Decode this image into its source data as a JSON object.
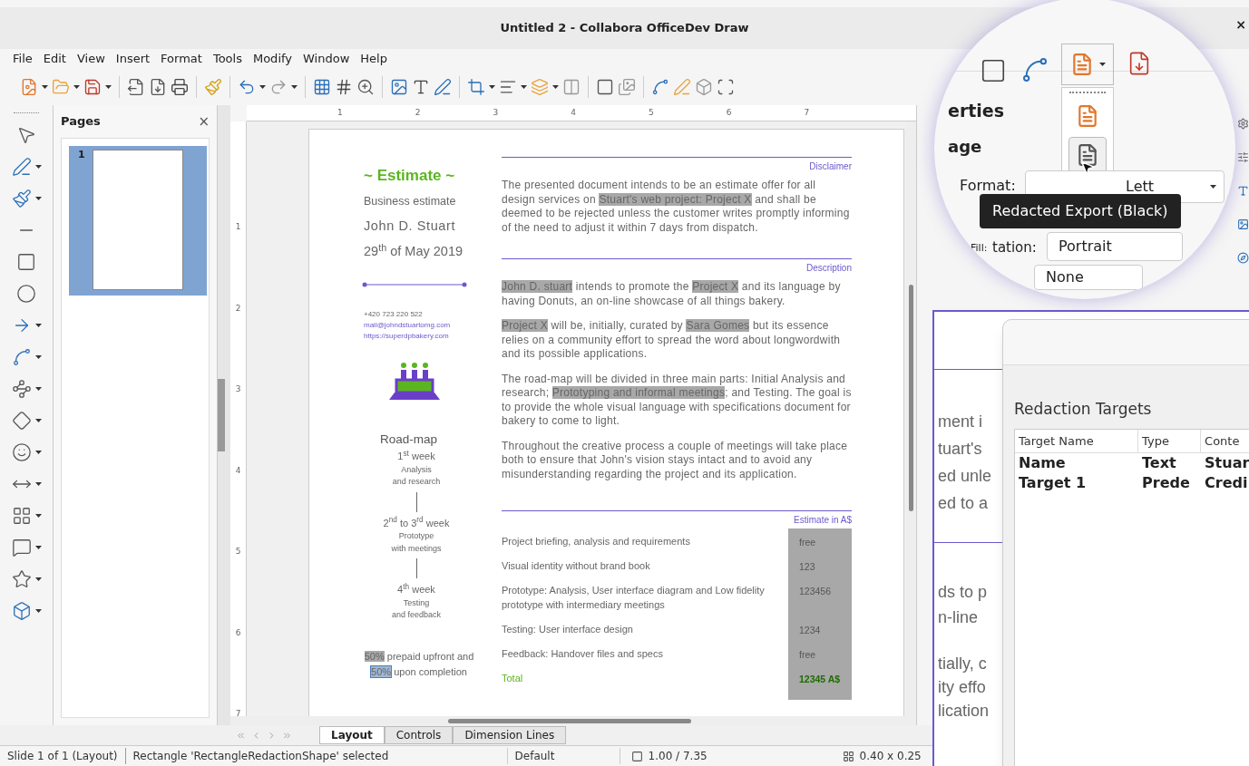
{
  "window": {
    "title": "Untitled 2 - Collabora OfficeDev Draw",
    "close": "×"
  },
  "menu": [
    "File",
    "Edit",
    "View",
    "Insert",
    "Format",
    "Tools",
    "Modify",
    "Window",
    "Help"
  ],
  "pages_panel": {
    "title": "Pages",
    "close": "×",
    "pages": [
      {
        "number": "1",
        "selected": true
      }
    ]
  },
  "ruler": {
    "h": [
      "1",
      "2",
      "3",
      "4",
      "5",
      "6",
      "7"
    ],
    "v": [
      "1",
      "2",
      "3",
      "4",
      "5",
      "6",
      "7"
    ]
  },
  "document": {
    "left": {
      "title": "~ Estimate ~",
      "subtitle": "Business estimate",
      "name": "John D. Stuart",
      "date": "29$^{th}$ of May 2019",
      "phone": "+420 723 220 522",
      "email": "mail@johndstuartomg.com",
      "url": "https://superdpbakery.com",
      "roadmap_title": "Road-map",
      "roadmap": [
        {
          "week": "1$^{st}$ week",
          "task": "Analysis",
          "task2": "and research"
        },
        {
          "week": "2$^{nd}$ to 3$^{rd}$ week",
          "task": "Prototype",
          "task2": "with meetings"
        },
        {
          "week": "4$^{th}$ week",
          "task": "Testing",
          "task2": "and feedback"
        }
      ],
      "payment": [
        {
          "text": "50%",
          "redacted": true,
          "selected": false
        },
        {
          "text": " prepaid upfront and ",
          "redacted": false,
          "selected": false
        },
        {
          "text": "50%",
          "redacted": true,
          "selected": true
        },
        {
          "text": " upon completion",
          "redacted": false,
          "selected": false
        }
      ]
    },
    "sections": [
      {
        "heading": "Disclaimer",
        "paragraphs": [
          [
            {
              "text": "The presented document intends to be an estimate offer for all design services on ",
              "redacted": false
            },
            {
              "text": "Stuart's web project: Project X",
              "redacted": true
            },
            {
              "text": " and shall be deemed to be rejected unless the customer writes promptly informing of the need to adjust it within 7 days from dispatch.",
              "redacted": false
            }
          ]
        ]
      },
      {
        "heading": "Description",
        "paragraphs": [
          [
            {
              "text": "John D. stuart",
              "redacted": true
            },
            {
              "text": " intends to promote the ",
              "redacted": false
            },
            {
              "text": "Project X",
              "redacted": true
            },
            {
              "text": " and its language by having Donuts, an on-line showcase of all things bakery.",
              "redacted": false
            }
          ],
          [
            {
              "text": "Project X",
              "redacted": true
            },
            {
              "text": " will be, initially, curated by ",
              "redacted": false
            },
            {
              "text": "Sara Gomes",
              "redacted": true
            },
            {
              "text": " but its essence relies on a community effort to spread the word about longwordwith and its possible applications.",
              "redacted": false
            }
          ],
          [
            {
              "text": "The road-map will be divided in three main parts: Initial Analysis and research; ",
              "redacted": false
            },
            {
              "text": "Prototyping and informal meetings",
              "redacted": true
            },
            {
              "text": "; and Testing. The goal is to provide the whole visual language with specifications document for bakery to come to light.",
              "redacted": false
            }
          ],
          [
            {
              "text": "Throughout the creative process a couple of meetings will take place both to ensure that John's vision stays intact and to avoid any misunderstanding regarding the project and its application.",
              "redacted": false
            }
          ]
        ]
      }
    ],
    "estimate": {
      "heading": "Estimate in A$",
      "rows": [
        {
          "label": "Project briefing, analysis and requirements",
          "price": "free",
          "kind": "item"
        },
        {
          "label": "Visual identity without brand book",
          "price": "123",
          "kind": "item"
        },
        {
          "label": "Prototype: Analysis, User interface diagram and Low fidelity prototype with intermediary meetings",
          "price": "123456",
          "kind": "item"
        },
        {
          "label": "Testing: User interface design",
          "price": "1234",
          "kind": "item"
        },
        {
          "label": "Feedback: Handover files and specs",
          "price": "free",
          "kind": "item"
        },
        {
          "label": "Total",
          "price": "12345 A$",
          "kind": "total"
        }
      ]
    }
  },
  "sheet_tabs": [
    {
      "label": "Layout",
      "selected": true
    },
    {
      "label": "Controls",
      "selected": false
    },
    {
      "label": "Dimension Lines",
      "selected": false
    }
  ],
  "status_bar": {
    "slide": "Slide 1 of 1 (Layout)",
    "selection": "Rectangle 'RectangleRedactionShape' selected",
    "style": "Default",
    "position": "1.00 / 7.35",
    "size": "0.40 x 0.25"
  },
  "magnifier": {
    "panel_title": "erties",
    "section": "age",
    "format_label": "Format:",
    "format_value": "Lett",
    "fill_label": "Fill:",
    "orientation_label": "tation:",
    "orientation_value": "Portrait",
    "fill_value": "None",
    "tooltip": "Redacted Export (Black)"
  },
  "inset": {
    "fragments_a": [
      "ment i",
      "tuart's",
      "ed unle",
      "ed to a"
    ],
    "fragments_b": [
      "ds to p",
      "n-line"
    ],
    "fragments_c": [
      "tially, c",
      "ity effo",
      "lication"
    ],
    "dialog": {
      "title": "Redaction Targets",
      "columns": [
        "Target Name",
        "Type",
        "Conte"
      ],
      "rows": [
        [
          "Name",
          "Text",
          "Stuar"
        ],
        [
          "Target 1",
          "Prede",
          "Credi"
        ]
      ]
    }
  }
}
